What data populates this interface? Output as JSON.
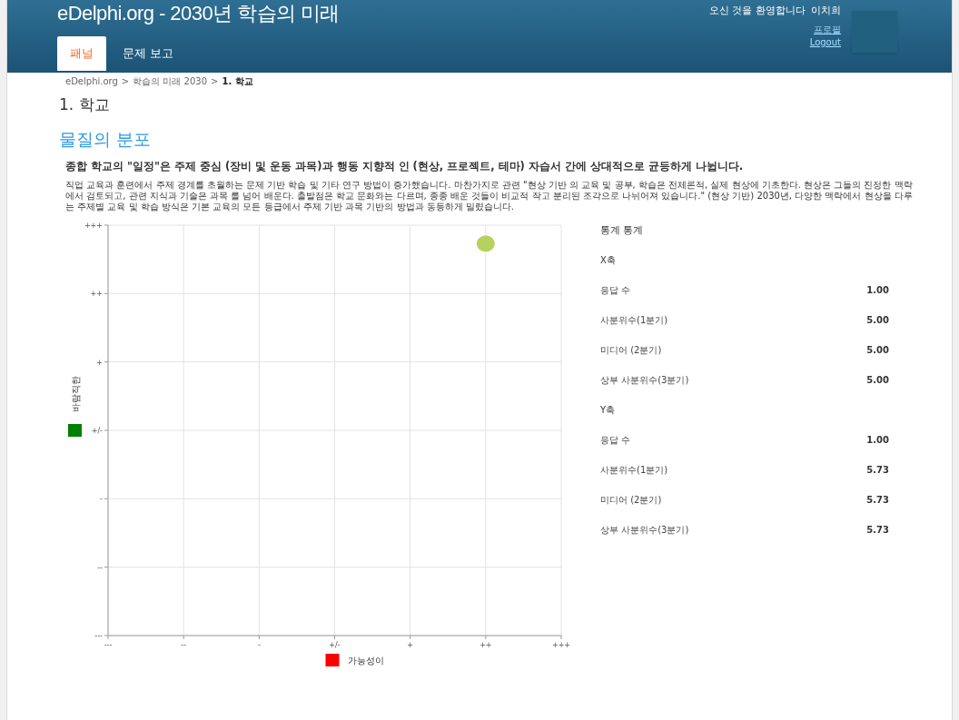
{
  "header": {
    "title": "eDelphi.org - 2030년 학습의 미래",
    "welcome": "오신 것을 환영합니다",
    "user_name": "이치희",
    "links": [
      "프로필",
      "Logout"
    ]
  },
  "tabs": [
    {
      "label": "패널",
      "selected": true
    },
    {
      "label": "문제 보고",
      "selected": false
    }
  ],
  "breadcrumb": [
    {
      "kind": "link",
      "text": "eDelphi.org"
    },
    {
      "kind": "separator",
      "text": ">"
    },
    {
      "kind": "link",
      "text": "학습의 미래 2030"
    },
    {
      "kind": "separator",
      "text": ">"
    },
    {
      "kind": "current",
      "text": "1. 학교"
    }
  ],
  "page_title": "1. 학교",
  "question": {
    "title": "물질의 분포",
    "lead": "종합 학교의 \"일정\"은 주제 중심 (장비 및 운동 과목)과 행동 지향적 인 (현상, 프로젝트, 테마) 자습서 간에 상대적으로 균등하게 나뉩니다.",
    "description": "직업 교육과 훈련에서 주제 경계를 초월하는 문제 기반 학습 및 기타 연구 방법이 증가했습니다. 마찬가지로 관련 \"현상 기반 의 교육 및 공부, 학습은 전체론적, 실제 현상에 기초한다. 현상은 그들의 진정한 맥락에서 검토되고, 관련 지식과 기술은 과목 를 넘어 배운다. 출발점은 학교 문화와는 다르며, 종종 배운 것들이 비교적 작고 분리된 조각으로 나뉘어져 있습니다.\" (현상 기반) 2030년, 다양한 맥락에서 현상을 다루는 주제별 교육 및 학습 방식은 기본 교육의 모든 등급에서 주제 기반 과목 기반의 방법과 동등하게 밀렸습니다."
  },
  "chart": {
    "xlabel": "가능성이",
    "ylabel": "바람직한",
    "x_tick_labels": [
      "---",
      "--",
      "-",
      "+/-",
      "+",
      "++",
      "+++"
    ],
    "y_tick_labels": [
      "+++",
      "++",
      "+",
      "+/-",
      "-",
      "--",
      "---"
    ]
  },
  "statistics": {
    "title": "통계 통계",
    "sections": [
      {
        "title": "X축",
        "rows": [
          {
            "label": "응답 수",
            "value": "1.00"
          },
          {
            "label": "사분위수(1분기)",
            "value": "5.00"
          },
          {
            "label": "미디어 (2분기)",
            "value": "5.00"
          },
          {
            "label": "상부 사분위수(3분기)",
            "value": "5.00"
          }
        ]
      },
      {
        "title": "Y축",
        "rows": [
          {
            "label": "응답 수",
            "value": "1.00"
          },
          {
            "label": "사분위수(1분기)",
            "value": "5.73"
          },
          {
            "label": "미디어 (2분기)",
            "value": "5.73"
          },
          {
            "label": "상부 사분위수(3분기)",
            "value": "5.73"
          }
        ]
      }
    ]
  }
}
